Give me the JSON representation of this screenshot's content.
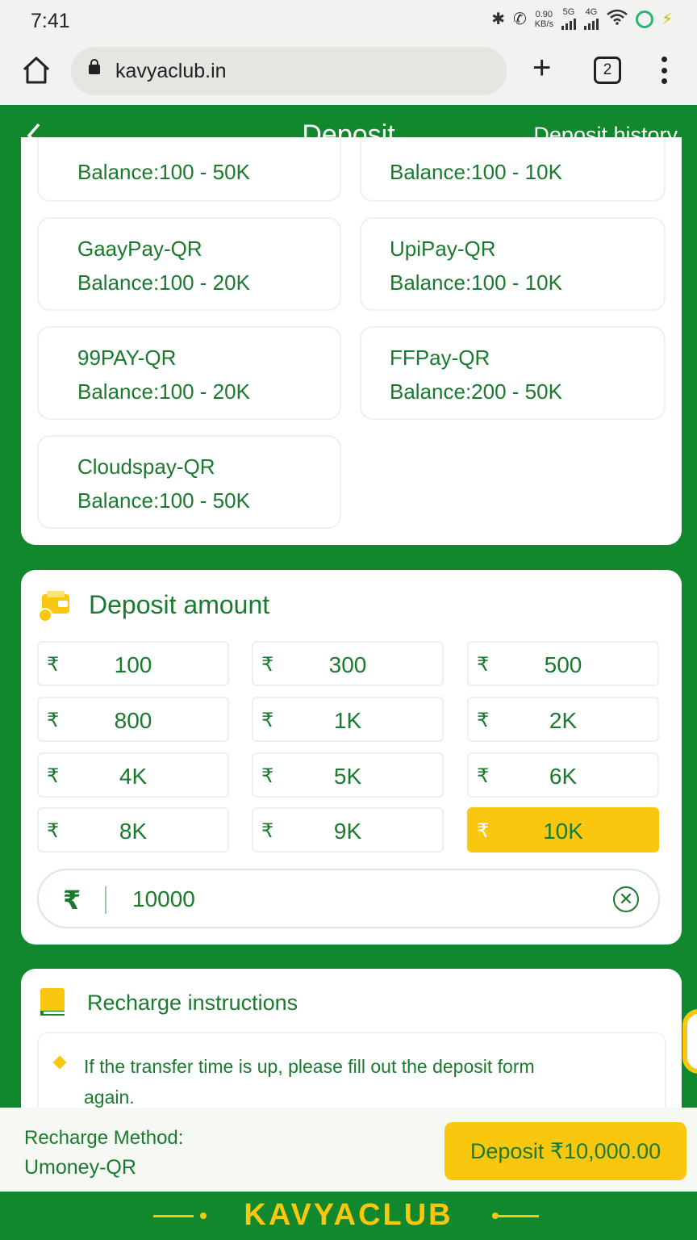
{
  "status_bar": {
    "time": "7:41",
    "net_speed_value": "0.90",
    "net_speed_unit": "KB/s",
    "sim1": "5G",
    "sim2": "4G"
  },
  "browser": {
    "url": "kavyaclub.in",
    "tab_count": "2"
  },
  "header": {
    "title": "Deposit",
    "history_link": "Deposit history"
  },
  "payment_channels": [
    {
      "name": "",
      "balance": "Balance:100 - 50K"
    },
    {
      "name": "",
      "balance": "Balance:100 - 10K"
    },
    {
      "name": "GaayPay-QR",
      "balance": "Balance:100 - 20K"
    },
    {
      "name": "UpiPay-QR",
      "balance": "Balance:100 - 10K"
    },
    {
      "name": "99PAY-QR",
      "balance": "Balance:100 - 20K"
    },
    {
      "name": "FFPay-QR",
      "balance": "Balance:200 - 50K"
    },
    {
      "name": "Cloudspay-QR",
      "balance": "Balance:100 - 50K"
    }
  ],
  "deposit_amount": {
    "title": "Deposit amount",
    "currency_symbol": "₹",
    "options": [
      "100",
      "300",
      "500",
      "800",
      "1K",
      "2K",
      "4K",
      "5K",
      "6K",
      "8K",
      "9K",
      "10K"
    ],
    "selected": "10K",
    "input_value": "10000"
  },
  "instructions": {
    "title": "Recharge instructions",
    "items": [
      "If the transfer time is up, please fill out the deposit form again."
    ]
  },
  "bottom": {
    "method_label": "Recharge Method:",
    "method_value": "Umoney-QR",
    "deposit_button": "Deposit ₹10,000.00"
  },
  "footer": {
    "brand": "KAVYACLUB"
  },
  "colors": {
    "brand_green": "#12882e",
    "text_green": "#1a7a2e",
    "accent_yellow": "#f9c80e"
  }
}
